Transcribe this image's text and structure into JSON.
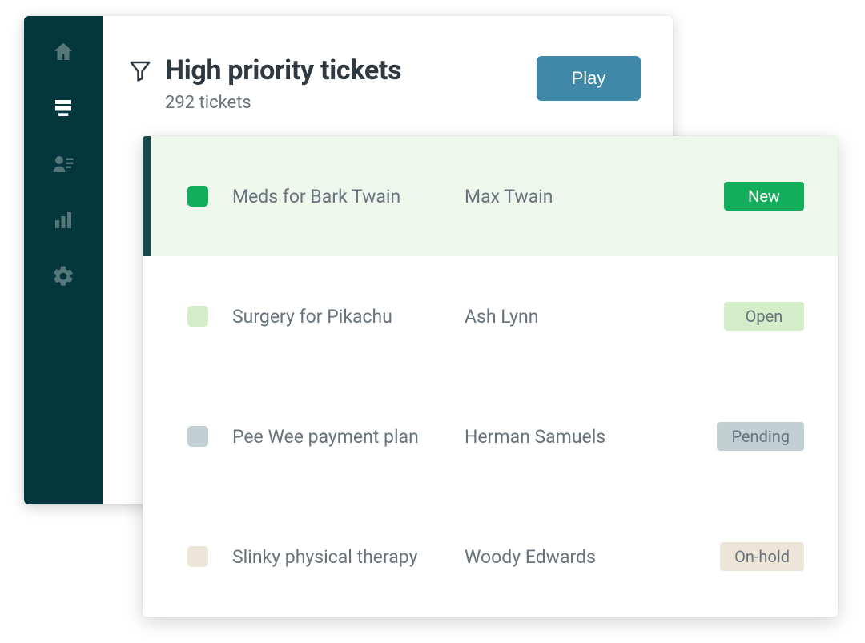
{
  "header": {
    "title": "High priority tickets",
    "subtitle": "292 tickets",
    "play_label": "Play"
  },
  "tickets": [
    {
      "subject": "Meds for Bark Twain",
      "requester": "Max Twain",
      "status": "New",
      "checkbox_color": "#13ae5c",
      "badge_bg": "#13ae5c",
      "badge_fg": "#ffffff",
      "selected": true
    },
    {
      "subject": "Surgery for Pikachu",
      "requester": "Ash Lynn",
      "status": "Open",
      "checkbox_color": "#d4edc9",
      "badge_bg": "#d4edc9",
      "badge_fg": "#68737d",
      "selected": false
    },
    {
      "subject": "Pee Wee payment plan",
      "requester": "Herman Samuels",
      "status": "Pending",
      "checkbox_color": "#c2d0d3",
      "badge_bg": "#c2d0d3",
      "badge_fg": "#68737d",
      "selected": false
    },
    {
      "subject": "Slinky physical therapy",
      "requester": "Woody Edwards",
      "status": "On-hold",
      "checkbox_color": "#ece5d8",
      "badge_bg": "#ece5d8",
      "badge_fg": "#68737d",
      "selected": false
    }
  ]
}
